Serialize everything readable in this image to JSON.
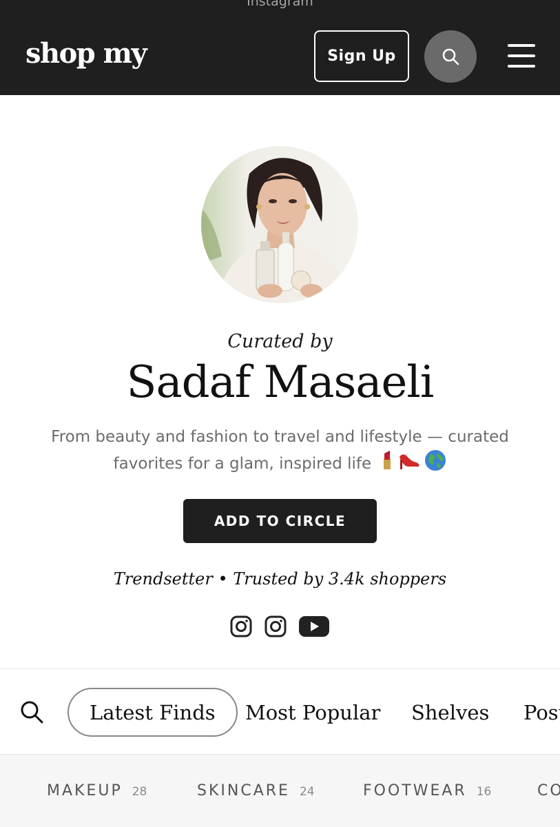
{
  "browser": {
    "title": "Instagram"
  },
  "header": {
    "logo": "shop my",
    "signup_label": "Sign Up",
    "search_icon": "search-icon",
    "menu_icon": "hamburger-menu-icon",
    "background": "#1f1f1f"
  },
  "profile": {
    "curated_by": "Curated by",
    "name": "Sadaf Masaeli",
    "bio_text": "From beauty and fashion to travel and lifestyle — curated favorites for a glam, inspired life",
    "bio_emojis": [
      "lipstick",
      "high-heel",
      "globe"
    ],
    "add_to_circle_label": "ADD TO CIRCLE",
    "trust_line": "Trendsetter • Trusted by 3.4k shoppers",
    "socials": [
      "instagram-icon",
      "instagram-icon",
      "youtube-icon"
    ]
  },
  "tabs": {
    "items": [
      {
        "label": "Latest Finds",
        "active": true
      },
      {
        "label": "Most Popular",
        "active": false
      },
      {
        "label": "Shelves",
        "active": false
      },
      {
        "label": "Post",
        "active": false
      }
    ]
  },
  "categories": [
    {
      "label": "MAKEUP",
      "count": "28"
    },
    {
      "label": "SKINCARE",
      "count": "24"
    },
    {
      "label": "FOOTWEAR",
      "count": "16"
    },
    {
      "label": "CO",
      "count": ""
    }
  ]
}
